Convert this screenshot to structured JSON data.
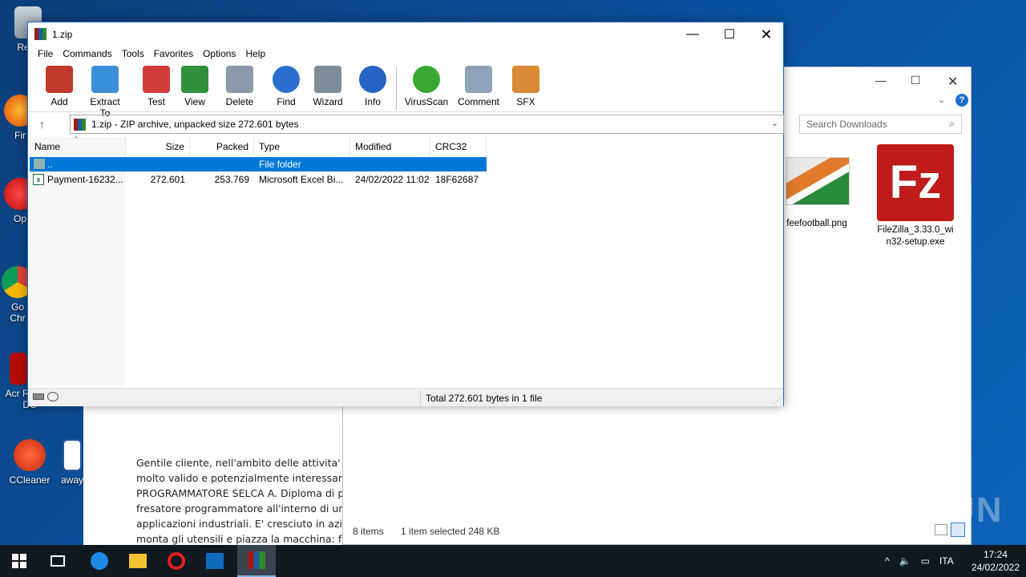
{
  "desktop": {
    "icons": [
      {
        "label": "Recy"
      },
      {
        "label": "Fir"
      },
      {
        "label": "Op"
      },
      {
        "label": "Go Chr"
      },
      {
        "label": "Acr Reader DC"
      },
      {
        "label": "CCleaner"
      },
      {
        "label": "away"
      }
    ],
    "watermark": "ANY RUN"
  },
  "document": {
    "text": "Gentile cliente, nell'ambito delle attivita' pr\nmolto valido e potenzialmente interessant\nPROGRAMMATORE SELCA A. Diploma di pe\nfresatore programmatore all'interno di un'\napplicazioni industriali.  E' cresciuto in azien\nmonta gli utensili e piazza la macchina: fres\nprogramma via terminale dai colleghi al Cad/Cam. Sa leggere autonomamente il disegno meccanico. Lavora su materiali"
  },
  "explorer": {
    "search_placeholder": "Search Downloads",
    "files": [
      {
        "name": "feefootball.png"
      },
      {
        "name": "FileZilla_3.33.0_wi\nn32-setup.exe"
      }
    ],
    "status": {
      "items": "8 items",
      "selected": "1 item selected  248 KB"
    }
  },
  "rar": {
    "title": "1.zip",
    "menu": [
      "File",
      "Commands",
      "Tools",
      "Favorites",
      "Options",
      "Help"
    ],
    "toolbar": [
      {
        "label": "Add",
        "icon": "add-archive-icon",
        "color": "#c0392b"
      },
      {
        "label": "Extract To",
        "icon": "extract-folder-icon",
        "color": "#3b8fd6"
      },
      {
        "label": "Test",
        "icon": "test-checklist-icon",
        "color": "#d23b3b"
      },
      {
        "label": "View",
        "icon": "view-book-icon",
        "color": "#2f8f3a"
      },
      {
        "label": "Delete",
        "icon": "trash-icon",
        "color": "#8b9aa8"
      },
      {
        "label": "Find",
        "icon": "magnifier-icon",
        "color": "#2c6fcf"
      },
      {
        "label": "Wizard",
        "icon": "magic-wand-icon",
        "color": "#7d8c99"
      },
      {
        "label": "Info",
        "icon": "info-icon",
        "color": "#2563c4"
      },
      {
        "label": "VirusScan",
        "icon": "virus-scan-icon",
        "color": "#3aa832"
      },
      {
        "label": "Comment",
        "icon": "comment-icon",
        "color": "#8fa2b8"
      },
      {
        "label": "SFX",
        "icon": "sfx-box-icon",
        "color": "#d98a35"
      }
    ],
    "path": "1.zip - ZIP archive, unpacked size 272.601 bytes",
    "columns": [
      "Name",
      "Size",
      "Packed",
      "Type",
      "Modified",
      "CRC32"
    ],
    "rows": [
      {
        "name": "..",
        "size": "",
        "packed": "",
        "type": "File folder",
        "modified": "",
        "crc": ""
      },
      {
        "name": "Payment-16232...",
        "size": "272.601",
        "packed": "253.769",
        "type": "Microsoft Excel Bi...",
        "modified": "24/02/2022 11:02",
        "crc": "18F62687"
      }
    ],
    "status": "Total 272.601 bytes in 1 file"
  },
  "taskbar": {
    "lang": "ITA",
    "time": "17:24",
    "date": "24/02/2022"
  }
}
